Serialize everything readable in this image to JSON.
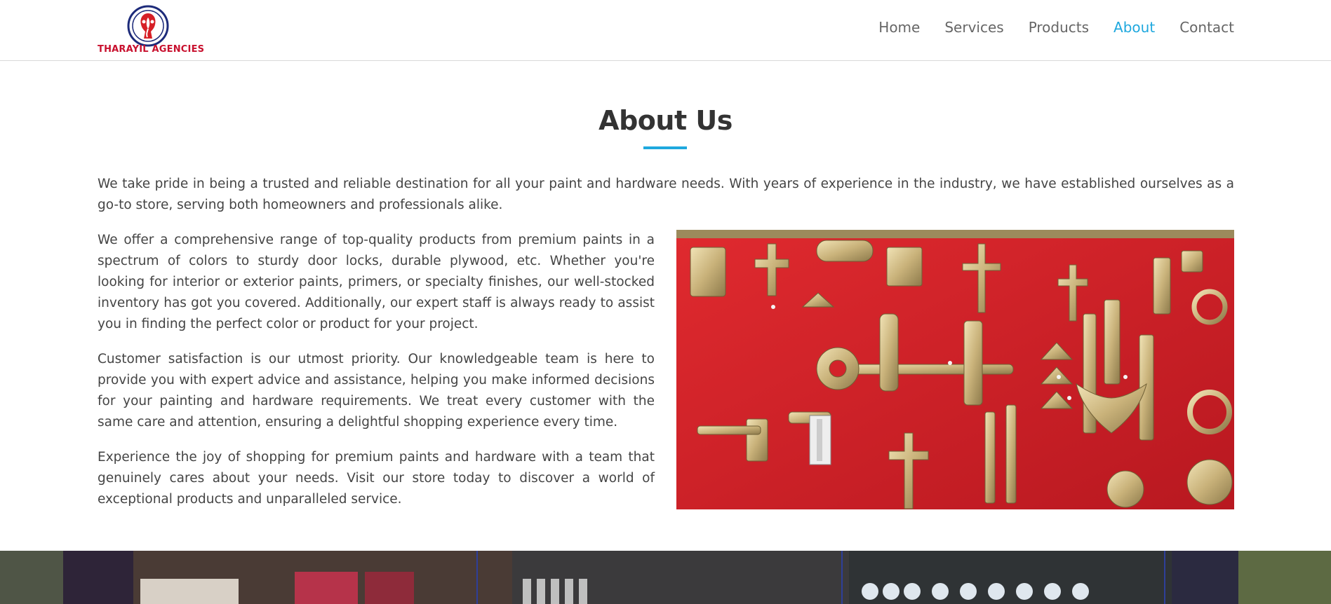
{
  "brand": {
    "name": "THARAYIL AGENCIES",
    "logo_icon": "ganesha-emblem-icon",
    "colors": {
      "brand_red": "#c8102e",
      "emblem_blue": "#1d2b7a"
    }
  },
  "nav": {
    "items": [
      {
        "label": "Home",
        "active": false
      },
      {
        "label": "Services",
        "active": false
      },
      {
        "label": "Products",
        "active": false
      },
      {
        "label": "About",
        "active": true
      },
      {
        "label": "Contact",
        "active": false
      }
    ],
    "active_color": "#1fa8de"
  },
  "about": {
    "title": "About Us",
    "accent_color": "#1fa8de",
    "intro": "We take pride in being a trusted and reliable destination for all your paint and hardware needs. With years of experience in the industry, we have established ourselves as a go-to store, serving both homeowners and professionals alike.",
    "paragraphs": [
      "We offer a comprehensive range of top-quality products from premium paints in a spectrum of colors to sturdy door locks, durable plywood, etc. Whether you're looking for interior or exterior paints, primers, or specialty finishes, our well-stocked inventory has got you covered. Additionally, our expert staff is always ready to assist you in finding the perfect color or product for your project.",
      "Customer satisfaction is our utmost priority. Our knowledgeable team is here to provide you with expert advice and assistance, helping you make informed decisions for your painting and hardware requirements. We treat every customer with the same care and attention, ensuring a delightful shopping experience every time.",
      "Experience the joy of shopping for premium paints and hardware with a team that genuinely cares about your needs. Visit our store today to discover a world of exceptional products and unparalleled service."
    ],
    "image_icon": "brass-hardware-display-image",
    "image_bg_color": "#d3222a"
  },
  "banner": {
    "image_icon": "paint-store-shelves-image"
  }
}
